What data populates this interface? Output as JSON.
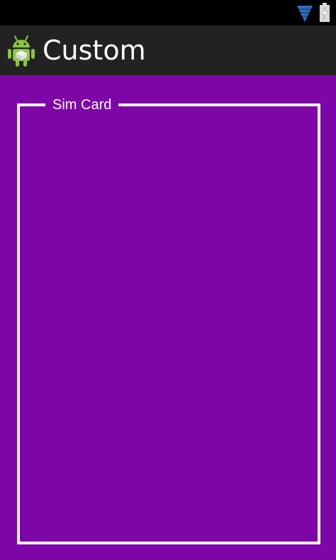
{
  "status_bar": {
    "icons": [
      "wifi-icon",
      "battery-charging-icon"
    ],
    "wifi_color": "#2f6fc4",
    "battery_color": "#d8d8d8"
  },
  "action_bar": {
    "icon": "android-icon",
    "title": "Custom"
  },
  "content": {
    "background": "#7e05a7",
    "group_box": {
      "label": "Sim Card",
      "border_color": "#ffffff"
    }
  }
}
